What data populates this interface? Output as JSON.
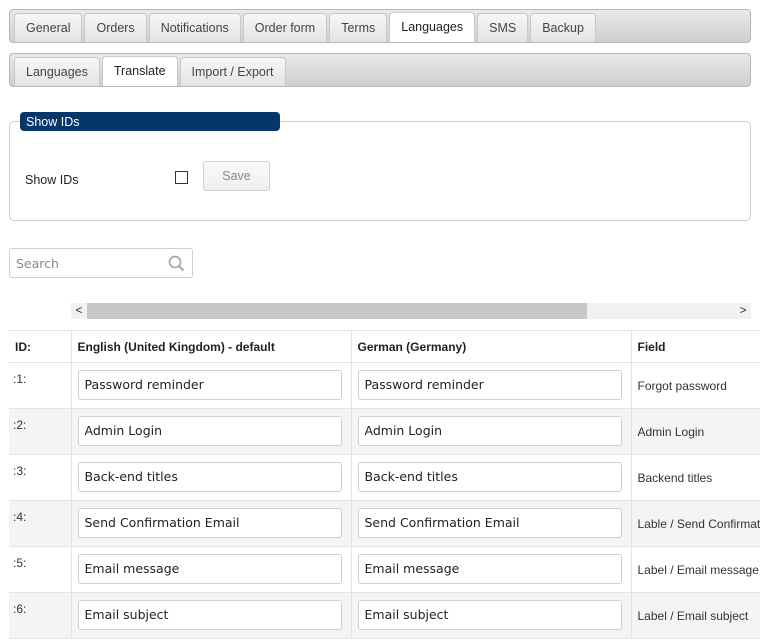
{
  "main_tabs": [
    {
      "label": "General",
      "active": false
    },
    {
      "label": "Orders",
      "active": false
    },
    {
      "label": "Notifications",
      "active": false
    },
    {
      "label": "Order form",
      "active": false
    },
    {
      "label": "Terms",
      "active": false
    },
    {
      "label": "Languages",
      "active": true
    },
    {
      "label": "SMS",
      "active": false
    },
    {
      "label": "Backup",
      "active": false
    }
  ],
  "sub_tabs": [
    {
      "label": "Languages",
      "active": false
    },
    {
      "label": "Translate",
      "active": true
    },
    {
      "label": "Import / Export",
      "active": false
    }
  ],
  "show_ids_section": {
    "legend": "Show IDs",
    "label": "Show IDs",
    "checked": false,
    "save_label": "Save"
  },
  "search": {
    "placeholder": "Search",
    "value": "",
    "icon": "search-icon"
  },
  "scrollbar": {
    "left_arrow": "<",
    "right_arrow": ">"
  },
  "table": {
    "headers": [
      "ID:",
      "English (United Kingdom) - default",
      "German (Germany)",
      "Field"
    ],
    "rows": [
      {
        "id": ":1:",
        "english": "Password reminder",
        "german": "Password reminder",
        "field": "Forgot password"
      },
      {
        "id": ":2:",
        "english": "Admin Login",
        "german": "Admin Login",
        "field": "Admin Login"
      },
      {
        "id": ":3:",
        "english": "Back-end titles",
        "german": "Back-end titles",
        "field": "Backend titles"
      },
      {
        "id": ":4:",
        "english": "Send Confirmation Email",
        "german": "Send Confirmation Email",
        "field": "Lable / Send Confirmation Email"
      },
      {
        "id": ":5:",
        "english": "Email message",
        "german": "Email message",
        "field": "Label / Email message"
      },
      {
        "id": ":6:",
        "english": "Email subject",
        "german": "Email subject",
        "field": "Label / Email subject"
      }
    ]
  }
}
